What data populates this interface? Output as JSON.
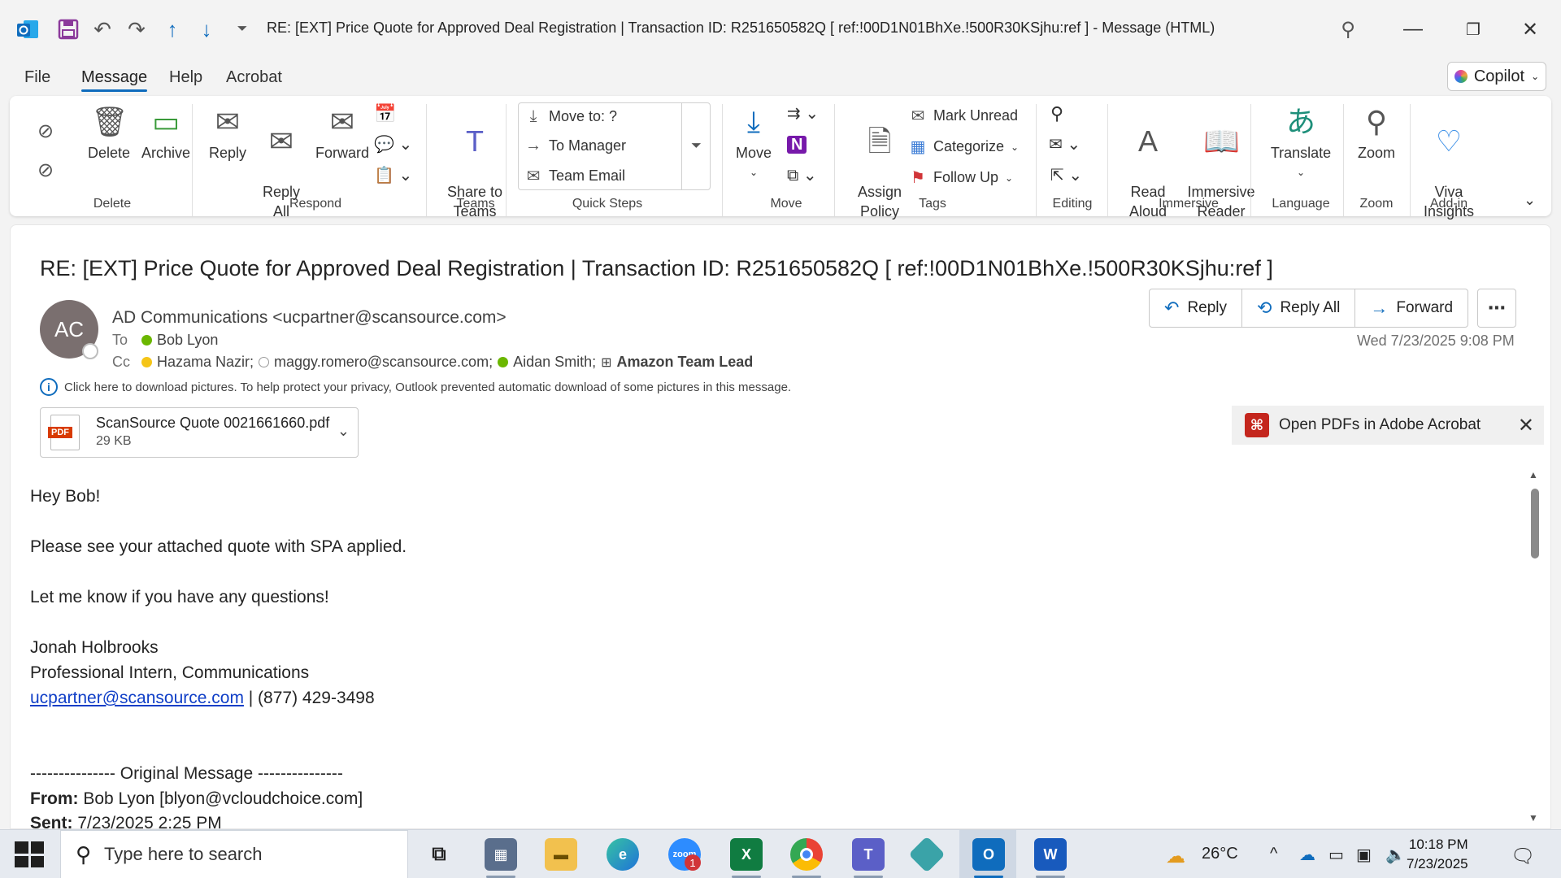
{
  "titlebar": {
    "title": "RE: [EXT] Price Quote for Approved Deal Registration | Transaction ID: R251650582Q    [ ref:!00D1N01BhXe.!500R30KSjhu:ref ]  -  Message (HTML)"
  },
  "menu": {
    "items": [
      "File",
      "Message",
      "Help",
      "Acrobat"
    ],
    "active": "Message",
    "copilot_label": "Copilot"
  },
  "ribbon": {
    "delete_group": {
      "delete_label": "Delete",
      "archive_label": "Archive",
      "group_label": "Delete"
    },
    "respond_group": {
      "reply_label": "Reply",
      "reply_all_label": "Reply\nAll",
      "forward_label": "Forward",
      "group_label": "Respond"
    },
    "teams_group": {
      "share_label": "Share to\nTeams",
      "group_label": "Teams"
    },
    "quick_steps": {
      "items": [
        "Move to: ?",
        "To Manager",
        "Team Email"
      ],
      "group_label": "Quick Steps"
    },
    "move_group": {
      "move_label": "Move",
      "group_label": "Move"
    },
    "tags_group": {
      "assign_label": "Assign\nPolicy",
      "mark_unread": "Mark Unread",
      "categorize": "Categorize",
      "follow_up": "Follow Up",
      "group_label": "Tags"
    },
    "editing_group": {
      "group_label": "Editing"
    },
    "immersive_group": {
      "read_aloud": "Read\nAloud",
      "immersive_reader": "Immersive\nReader",
      "group_label": "Immersive"
    },
    "language_group": {
      "translate": "Translate",
      "group_label": "Language"
    },
    "zoom_group": {
      "zoom": "Zoom",
      "group_label": "Zoom"
    },
    "addin_group": {
      "viva": "Viva\nInsights",
      "group_label": "Add-in"
    }
  },
  "message": {
    "subject": "RE: [EXT] Price Quote for Approved Deal Registration | Transaction ID: R251650582Q    [ ref:!00D1N01BhXe.!500R30KSjhu:ref ]",
    "avatar_initials": "AC",
    "sender": "AD Communications <ucpartner@scansource.com>",
    "to_label": "To",
    "to": "Bob Lyon",
    "cc_label": "Cc",
    "cc": [
      "Hazama Nazir;",
      "maggy.romero@scansource.com;",
      "Aidan Smith;",
      "Amazon Team Lead"
    ],
    "datetime": "Wed 7/23/2025 9:08 PM",
    "info": "Click here to download pictures. To help protect your privacy, Outlook prevented automatic download of some pictures in this message.",
    "attachment": {
      "name": "ScanSource Quote 0021661660.pdf",
      "size": "29 KB",
      "badge": "PDF"
    },
    "actions": {
      "reply": "Reply",
      "reply_all": "Reply All",
      "forward": "Forward"
    },
    "acrobat_banner": "Open PDFs in Adobe Acrobat",
    "body": {
      "greeting": "Hey Bob!",
      "line1": "Please see your attached quote with SPA applied.",
      "line2": "Let me know if you have any questions!",
      "sig_name": "Jonah Holbrooks",
      "sig_title": "Professional Intern, Communications",
      "sig_email": "ucpartner@scansource.com",
      "sig_phone": " | (877) 429-3498",
      "orig_header": "--------------- Original Message ---------------",
      "from_label": "From:",
      "from_value": " Bob Lyon [blyon@vcloudchoice.com]",
      "sent_label": "Sent:",
      "sent_value": " 7/23/2025 2:25 PM"
    }
  },
  "taskbar": {
    "search_placeholder": "Type here to search",
    "weather": "26°C",
    "time": "10:18 PM",
    "date": "7/23/2025",
    "zoom_badge": "1"
  },
  "colors": {
    "accent": "#0f6cbd",
    "outlook": "#0f6cbd",
    "link": "#0f3ec7"
  }
}
